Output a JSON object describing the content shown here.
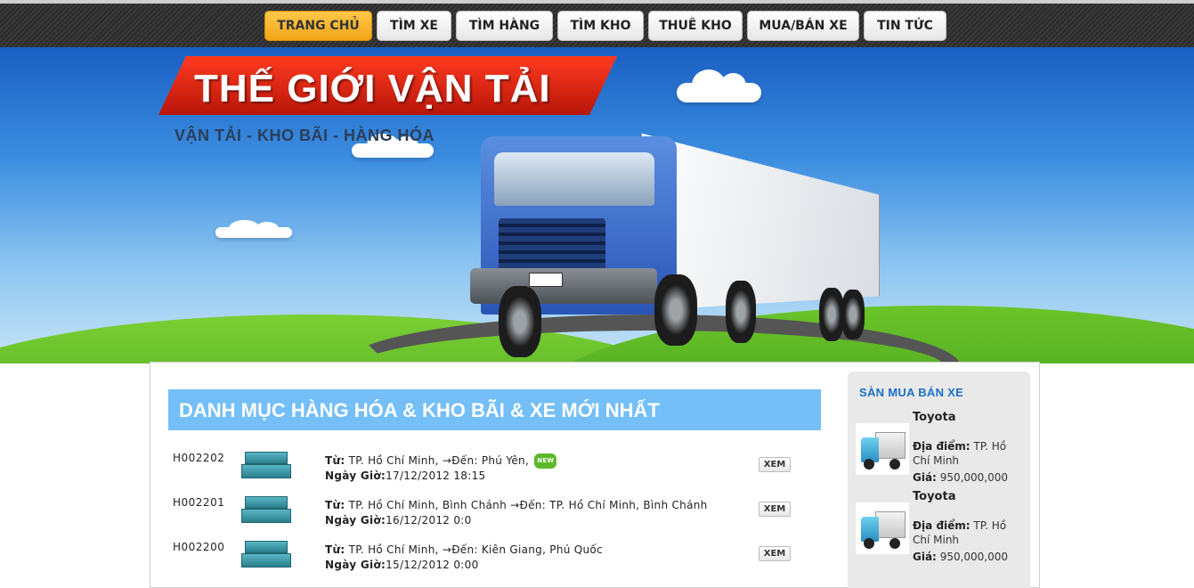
{
  "nav": {
    "items": [
      {
        "label": "TRANG CHỦ",
        "active": true
      },
      {
        "label": "TÌM XE"
      },
      {
        "label": "TÌM HÀNG"
      },
      {
        "label": "TÌM KHO"
      },
      {
        "label": "THUÊ KHO"
      },
      {
        "label": "MUA/BÁN XE"
      },
      {
        "label": "TIN TỨC"
      }
    ]
  },
  "banner": {
    "title": "THẾ GIỚI VẬN TẢI",
    "tagline": "VẬN TẢI - KHO BÃI - HÀNG HÓA"
  },
  "main": {
    "section_title": "DANH MỤC HÀNG HÓA & KHO BÃI & XE MỚI NHẤT",
    "from_label": "Từ:",
    "to_label": "→Đến:",
    "date_label": "Ngày Giờ:",
    "view_label": "XEM",
    "new_badge": "NEW",
    "rows": [
      {
        "code": "H002202",
        "from": "TP. Hồ Chí Minh,",
        "to": "Phú Yên,",
        "datetime": "17/12/2012 18:15",
        "is_new": true
      },
      {
        "code": "H002201",
        "from": "TP. Hồ Chí Minh, Bình Chánh",
        "to": "TP. Hồ Chí Minh, Bình Chánh",
        "datetime": "16/12/2012 0:0",
        "is_new": false
      },
      {
        "code": "H002200",
        "from": "TP. Hồ Chí Minh,",
        "to": "Kiên Giang, Phú Quốc",
        "datetime": "15/12/2012 0:00",
        "is_new": false
      }
    ]
  },
  "sidebar": {
    "title": "SÀN MUA BÁN XE",
    "location_label": "Địa điểm:",
    "price_label": "Giá:",
    "cars": [
      {
        "name": "Toyota",
        "location": "TP. Hồ Chí Minh",
        "price": "950,000,000"
      },
      {
        "name": "Toyota",
        "location": "TP. Hồ Chí Minh",
        "price": "950,000,000"
      }
    ]
  },
  "colors": {
    "active_tab": "#f2a417",
    "section_header": "#74bff7",
    "sidebar_title": "#1c6fc8",
    "logo_red": "#d8200f"
  }
}
